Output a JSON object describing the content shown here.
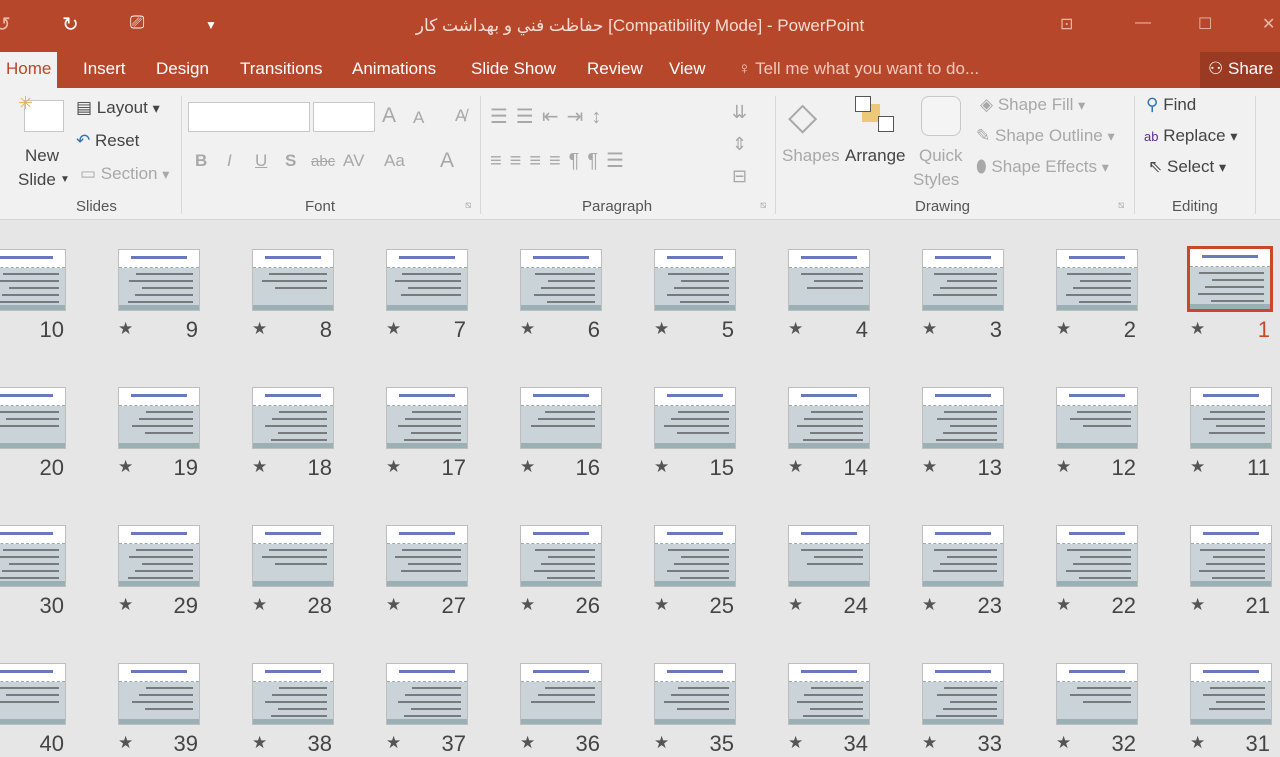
{
  "window": {
    "title": "حفاظت فني و بهداشت كار [Compatibility Mode] - PowerPoint"
  },
  "quick_access": {
    "undo_icon": "redo-icon",
    "present_icon": "start-presentation-icon",
    "customize_icon": "customize-dropdown-icon"
  },
  "tabs": [
    "Home",
    "Insert",
    "Design",
    "Transitions",
    "Animations",
    "Slide Show",
    "Review",
    "View"
  ],
  "tell_me": "Tell me what you want to do...",
  "share": "Share",
  "ribbon": {
    "slides": {
      "new_slide_1": "New",
      "new_slide_2": "Slide",
      "layout": "Layout",
      "reset": "Reset",
      "section": "Section",
      "group": "Slides"
    },
    "font": {
      "font_name": "",
      "font_size": "",
      "bold": "B",
      "italic": "I",
      "underline": "U",
      "shadow": "S",
      "strike": "abc",
      "spacing": "AV",
      "case": "Aa",
      "color": "A",
      "grow": "A",
      "shrink": "A",
      "group": "Font"
    },
    "paragraph": {
      "group": "Paragraph"
    },
    "drawing": {
      "shapes": "Shapes",
      "arrange": "Arrange",
      "quick_1": "Quick",
      "quick_2": "Styles",
      "fill": "Shape Fill",
      "outline": "Shape Outline",
      "effects": "Shape Effects",
      "group": "Drawing"
    },
    "editing": {
      "find": "Find",
      "replace": "Replace",
      "select": "Select",
      "group": "Editing"
    }
  },
  "accent": "#B7472A",
  "selected_slide": 1,
  "slides": [
    1,
    2,
    3,
    4,
    5,
    6,
    7,
    8,
    9,
    10,
    11,
    12,
    13,
    14,
    15,
    16,
    17,
    18,
    19,
    20,
    21,
    22,
    23,
    24,
    25,
    26,
    27,
    28,
    29,
    30,
    31,
    32,
    33,
    34,
    35,
    36,
    37,
    38,
    39,
    40
  ]
}
